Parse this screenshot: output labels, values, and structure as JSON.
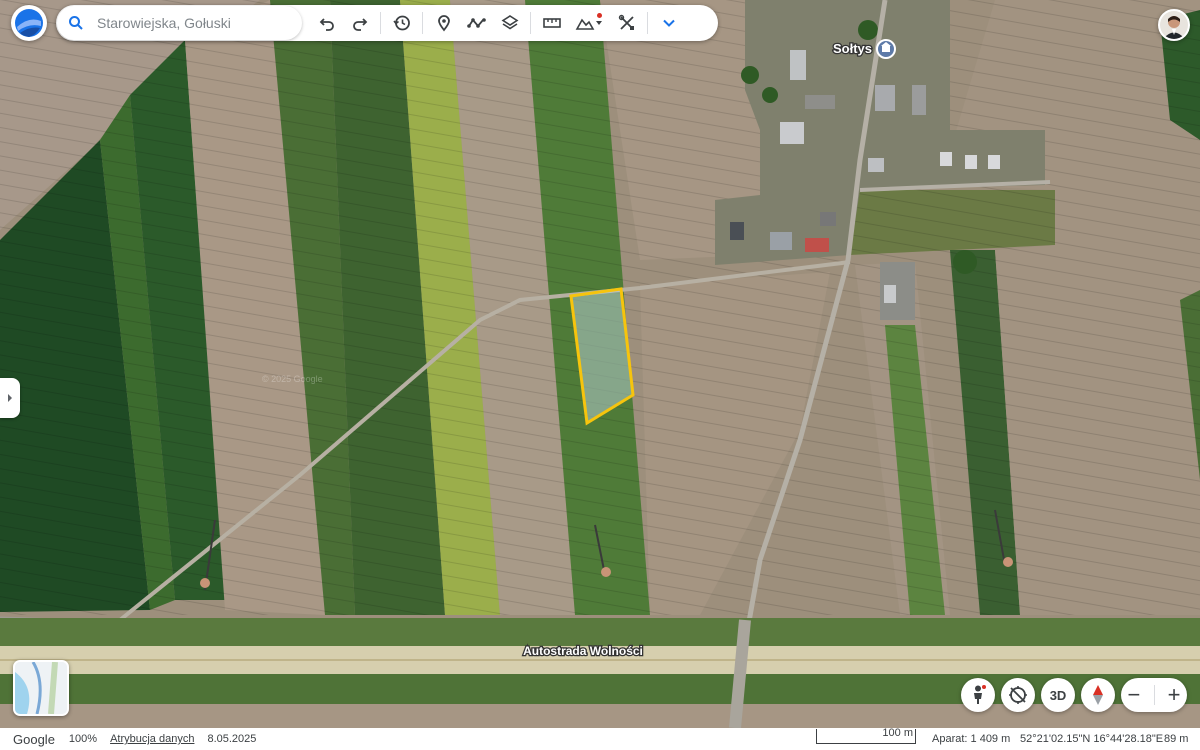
{
  "search": {
    "placeholder": "Starowiejska, Gołuski"
  },
  "map": {
    "place_label": "Sołtys",
    "road_label": "Autostrada Wolności",
    "imagery_watermark": "© 2025 Google"
  },
  "toolbar": {
    "icons": [
      "undo-icon",
      "redo-icon",
      "history-icon",
      "pin-icon",
      "path-icon",
      "layers-icon",
      "ruler-icon",
      "elevation-icon",
      "tools-icon",
      "chevron-down-icon"
    ],
    "accent": "#1a73e8"
  },
  "controls": {
    "view3d_label": "3D",
    "zoom_out": "−",
    "zoom_in": "+"
  },
  "status": {
    "brand": "Google",
    "zoom": "100%",
    "attribution": "Atrybucja danych",
    "date": "8.05.2025",
    "scale": "100 m",
    "camera": "Aparat: 1 409 m",
    "coords": "52°21'02.15\"N 16°44'28.18\"E",
    "elevation": "89 m"
  },
  "colors": {
    "selection": "#f6c40d",
    "brand_blue": "#1a73e8"
  }
}
